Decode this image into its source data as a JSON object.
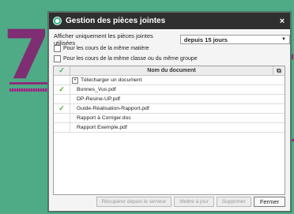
{
  "decor": {
    "number": "7"
  },
  "window": {
    "title": "Gestion des pièces jointes",
    "close": "×"
  },
  "filter": {
    "label": "Afficher uniquement les pièces jointes utilisées",
    "value": "depuis 15 jours",
    "caret": "▼"
  },
  "options": [
    {
      "label": "Pour les cours de la même matière",
      "checked": false
    },
    {
      "label": "Pour les cours de la même classe ou du même groupe",
      "checked": false
    }
  ],
  "grid": {
    "header_check": "✓",
    "header_name": "Nom du document",
    "header_icon": "⧉",
    "add_label": "Télécharger un document",
    "rows": [
      {
        "name": "Bonnes_Vus.pdf",
        "checked": true
      },
      {
        "name": "DP-Resine-UP.pdf",
        "checked": false
      },
      {
        "name": "Guide-Réalisation-Rapport.pdf",
        "checked": true
      },
      {
        "name": "Rapport à Corriger.doc",
        "checked": false
      },
      {
        "name": "Rapport Exemple.pdf",
        "checked": false
      }
    ]
  },
  "buttons": {
    "recover": "Récupérer depuis le serveur",
    "update": "Mettre à jour",
    "delete": "Supprimer",
    "close": "Fermer"
  }
}
